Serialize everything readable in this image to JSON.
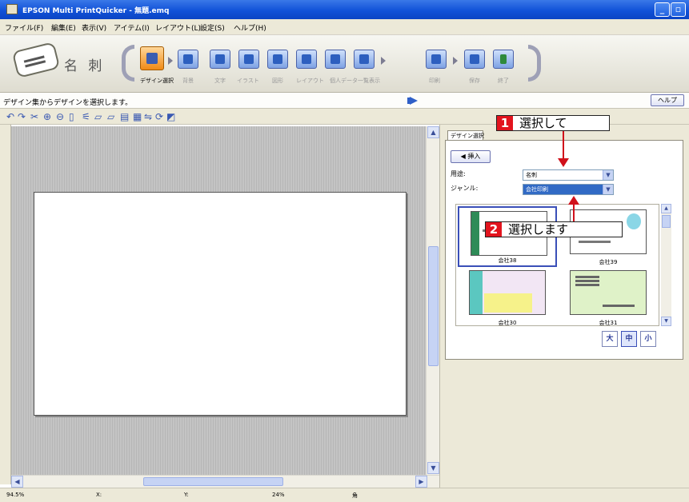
{
  "window": {
    "title": "EPSON Multi PrintQuicker - 無題.emq"
  },
  "menu": [
    {
      "label": "ファイル(F)"
    },
    {
      "label": "編集(E)"
    },
    {
      "label": "表示(V)"
    },
    {
      "label": "アイテム(I)"
    },
    {
      "label": "レイアウト(L)"
    },
    {
      "label": "設定(S)"
    },
    {
      "label": "ヘルプ(H)"
    }
  ],
  "product": {
    "name": "名 刺"
  },
  "steps": [
    {
      "label": "デザイン選択",
      "active": true
    },
    {
      "label": "背景"
    },
    {
      "label": "文字"
    },
    {
      "label": "イラスト"
    },
    {
      "label": "図形"
    },
    {
      "label": "レイアウト"
    },
    {
      "label": "個人データ一覧表示"
    },
    {
      "label": "印刷"
    },
    {
      "label": "保存"
    },
    {
      "label": "終了"
    }
  ],
  "instruction": {
    "text": "デザイン集からデザインを選択します。",
    "help_label": "ヘルプ"
  },
  "panel": {
    "tab_label": "デザイン選択",
    "insert_label": "◀ 挿入",
    "use_label": "用途:",
    "use_value": "名刺",
    "genre_label": "ジャンル:",
    "genre_value": "会社印刷"
  },
  "gallery": [
    {
      "caption": "会社38",
      "selected": true
    },
    {
      "caption": "会社39"
    },
    {
      "caption": "会社30"
    },
    {
      "caption": "会社31"
    }
  ],
  "size_buttons": [
    {
      "label": "大"
    },
    {
      "label": "中",
      "on": true
    },
    {
      "label": "小"
    }
  ],
  "callouts": [
    {
      "num": "1",
      "text": "選択して"
    },
    {
      "num": "2",
      "text": "選択します"
    }
  ],
  "statusbar": [
    {
      "text": "94.5%"
    },
    {
      "text": "X:"
    },
    {
      "text": "Y:"
    },
    {
      "text": "24%"
    },
    {
      "text": "角"
    }
  ],
  "colors": {
    "accent": "#e2141e",
    "titlebar": "#1152d8",
    "selection": "#316ac5"
  }
}
